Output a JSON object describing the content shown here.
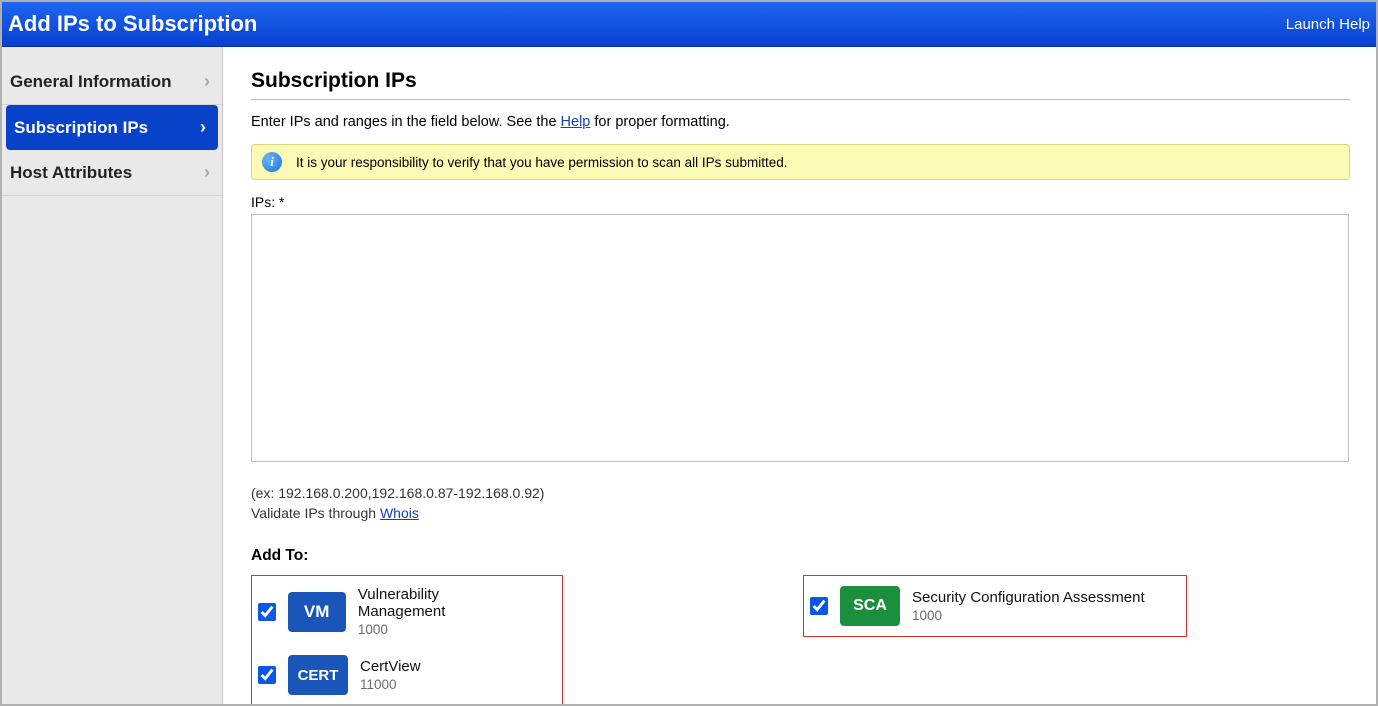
{
  "header": {
    "title": "Add IPs to Subscription",
    "help_link": "Launch Help"
  },
  "sidebar": {
    "items": [
      {
        "label": "General Information"
      },
      {
        "label": "Subscription IPs"
      },
      {
        "label": "Host Attributes"
      }
    ]
  },
  "main": {
    "title": "Subscription IPs",
    "intro_prefix": "Enter IPs and ranges in the field below. See the ",
    "intro_link": "Help",
    "intro_suffix": " for proper formatting.",
    "notice": "It is your responsibility to verify that you have permission to scan all IPs submitted.",
    "ips_label": "IPs: *",
    "ips_value": "",
    "example_line": "(ex: 192.168.0.200,192.168.0.87-192.168.0.92)",
    "validate_prefix": "Validate IPs through ",
    "validate_link": "Whois",
    "addto_label": "Add To:"
  },
  "modules": {
    "vm": {
      "badge": "VM",
      "name": "Vulnerability Management",
      "count": "1000",
      "checked": true
    },
    "cert": {
      "badge": "CERT",
      "name": "CertView",
      "count": "11000",
      "checked": true
    },
    "sca": {
      "badge": "SCA",
      "name": "Security Configuration Assessment",
      "count": "1000",
      "checked": true
    }
  }
}
